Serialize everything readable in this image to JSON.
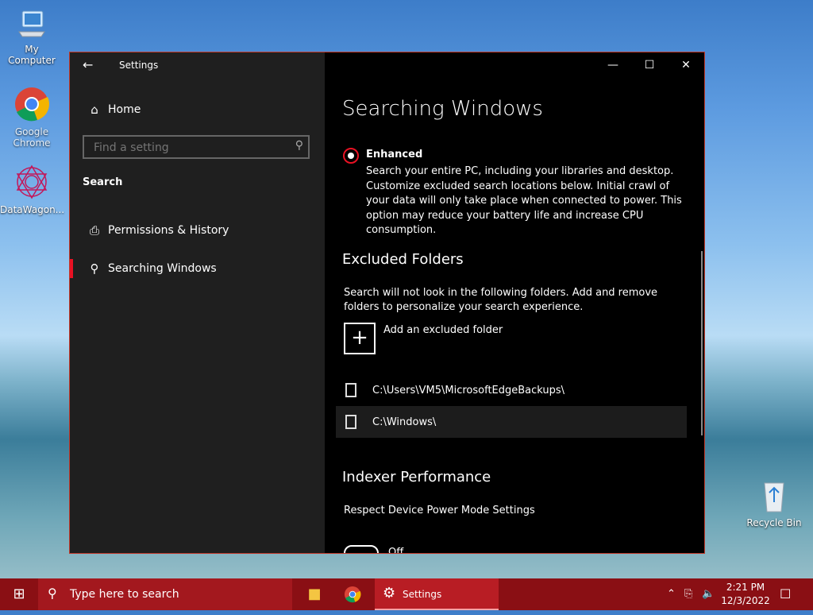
{
  "desktop": {
    "icons": [
      {
        "label": "My Computer"
      },
      {
        "label": "Google Chrome"
      },
      {
        "label": "DataWagon..."
      },
      {
        "label": "Recycle Bin"
      }
    ]
  },
  "window": {
    "title": "Settings",
    "minimize_icon": "minimize-icon",
    "maximize_icon": "maximize-icon",
    "close_icon": "close-icon"
  },
  "nav": {
    "home_label": "Home",
    "search_placeholder": "Find a setting",
    "section_label": "Search",
    "items": [
      {
        "label": "Permissions & History",
        "icon": "permissions-icon"
      },
      {
        "label": "Searching Windows",
        "icon": "search-icon"
      }
    ]
  },
  "content": {
    "page_title": "Searching Windows",
    "enhanced": {
      "title": "Enhanced",
      "selected": true,
      "description": "Search your entire PC, including your libraries and desktop. Customize excluded search locations below. Initial crawl of your data will only take place when connected to power. This option may reduce your battery life and increase CPU consumption."
    },
    "excluded": {
      "heading": "Excluded Folders",
      "description": "Search will not look in the following folders. Add and remove folders to personalize your search experience.",
      "add_label": "Add an excluded folder",
      "folders": [
        {
          "path": "C:\\Users\\VM5\\MicrosoftEdgeBackups\\"
        },
        {
          "path": "C:\\Windows\\"
        }
      ]
    },
    "indexer": {
      "heading": "Indexer Performance",
      "setting_label": "Respect Device Power Mode Settings",
      "toggle_state": "Off"
    }
  },
  "taskbar": {
    "search_placeholder": "Type here to search",
    "active_app_label": "Settings",
    "time": "2:21 PM",
    "date": "12/3/2022"
  },
  "colors": {
    "accent": "#e81123",
    "taskbar": "#8a0f14",
    "nav_bg": "#1f1f1f"
  }
}
